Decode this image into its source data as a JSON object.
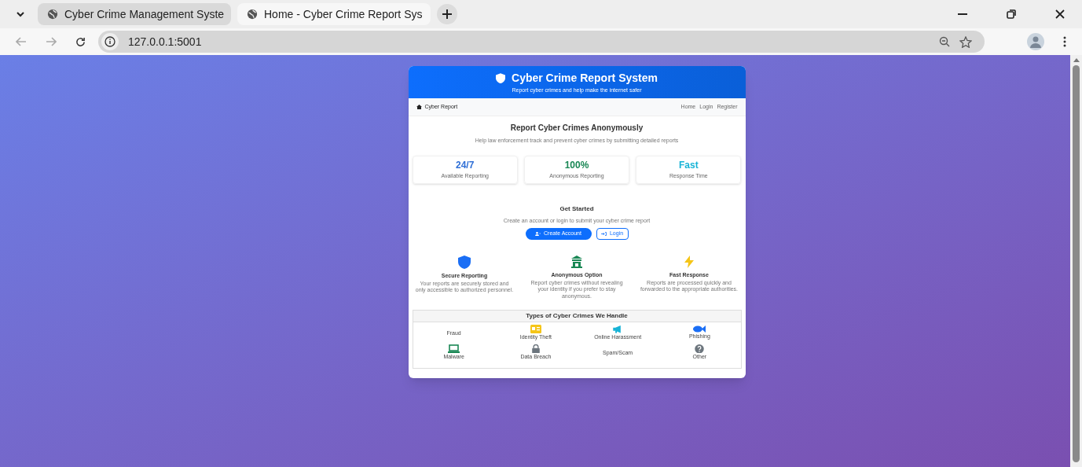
{
  "browser": {
    "tabs": [
      {
        "title": "Cyber Crime Management Syste",
        "selected": false
      },
      {
        "title": "Home - Cyber Crime Report Sys",
        "selected": true
      }
    ],
    "url": "127.0.0.1:5001"
  },
  "header": {
    "title": "Cyber Crime Report System",
    "subtitle": "Report cyber crimes and help make the internet safer"
  },
  "nav": {
    "brand": "Cyber Report",
    "links": [
      "Home",
      "Login",
      "Register"
    ]
  },
  "hero": {
    "title": "Report Cyber Crimes Anonymously",
    "subtitle": "Help law enforcement track and prevent cyber crimes by submitting detailed reports"
  },
  "stats": [
    {
      "value": "24/7",
      "label": "Available Reporting",
      "color": "#2f6fd6"
    },
    {
      "value": "100%",
      "label": "Anonymous Reporting",
      "color": "#198754"
    },
    {
      "value": "Fast",
      "label": "Response Time",
      "color": "#17b3d6"
    }
  ],
  "get_started": {
    "title": "Get Started",
    "subtitle": "Create an account or login to submit your cyber crime report",
    "buttons": [
      "Create Account",
      "Login"
    ]
  },
  "features": [
    {
      "title": "Secure Reporting",
      "text": "Your reports are securely stored and only accessible to authorized personnel."
    },
    {
      "title": "Anonymous Option",
      "text": "Report cyber crimes without revealing your identity if you prefer to stay anonymous."
    },
    {
      "title": "Fast Response",
      "text": "Reports are processed quickly and forwarded to the appropriate authorities."
    }
  ],
  "crime_types": {
    "title": "Types of Cyber Crimes We Handle",
    "items": [
      {
        "label": "Fraud",
        "kind": "text-only"
      },
      {
        "label": "Identity Theft",
        "kind": "with-icon"
      },
      {
        "label": "Online Harassment",
        "kind": "with-icon"
      },
      {
        "label": "Phishing",
        "kind": "with-icon"
      },
      {
        "label": "Malware",
        "kind": "with-icon"
      },
      {
        "label": "Data Breach",
        "kind": "with-icon"
      },
      {
        "label": "Spam/Scam",
        "kind": "text-only"
      },
      {
        "label": "Other",
        "kind": "with-icon"
      }
    ]
  }
}
